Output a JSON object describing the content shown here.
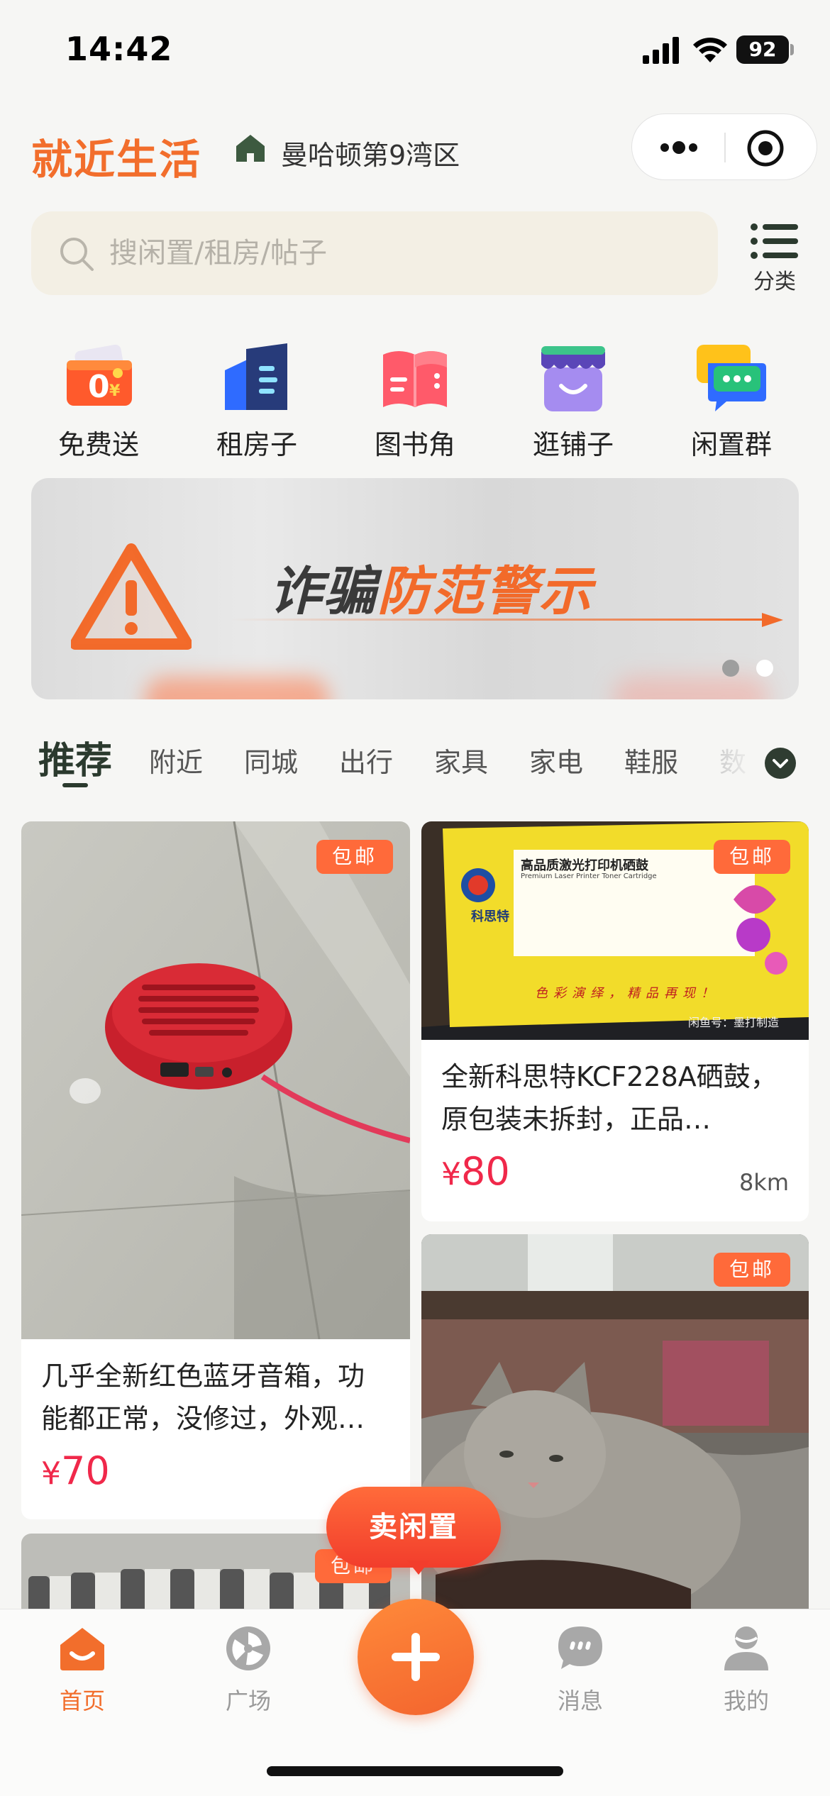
{
  "status_bar": {
    "time": "14:42",
    "battery": "92"
  },
  "header": {
    "brand": "就近生活",
    "location": "曼哈顿第9湾区"
  },
  "search": {
    "placeholder": "搜闲置/租房/帖子",
    "category_label": "分类"
  },
  "quick_nav": [
    {
      "label": "免费送",
      "icon": "free-gift-icon"
    },
    {
      "label": "租房子",
      "icon": "rent-house-icon"
    },
    {
      "label": "图书角",
      "icon": "book-corner-icon"
    },
    {
      "label": "逛铺子",
      "icon": "shop-icon"
    },
    {
      "label": "闲置群",
      "icon": "group-chat-icon"
    }
  ],
  "banner": {
    "text_dark": "诈骗",
    "text_accent": "防范警示",
    "slides": 2,
    "active_slide": 2
  },
  "tabs": [
    "推荐",
    "附近",
    "同城",
    "出行",
    "家具",
    "家电",
    "鞋服",
    "数"
  ],
  "products": [
    {
      "badge": "包邮",
      "title": "几乎全新红色蓝牙音箱，功能都正常，没修过，外观…",
      "price": "70",
      "currency": "¥"
    },
    {
      "badge": "包邮",
      "title": "全新科思特KCF228A硒鼓，原包装未拆封，正品…",
      "price": "80",
      "currency": "¥",
      "distance": "8km",
      "image_text": {
        "brand": "科思特",
        "title": "高品质激光打印机硒鼓",
        "subtitle": "Premium Laser Printer Toner Cartridge",
        "slogan": "色彩演绎，精品再现！",
        "corner": "闲鱼号：墨打制造"
      }
    },
    {
      "badge": "包邮"
    },
    {
      "badge": "包邮"
    }
  ],
  "sell_button": "卖闲置",
  "tabbar": [
    {
      "label": "首页",
      "icon": "home-icon",
      "active": true
    },
    {
      "label": "广场",
      "icon": "plaza-icon",
      "active": false
    },
    {
      "label": "",
      "icon": "plus-icon",
      "active": false
    },
    {
      "label": "消息",
      "icon": "message-icon",
      "active": false
    },
    {
      "label": "我的",
      "icon": "profile-icon",
      "active": false
    }
  ],
  "colors": {
    "brand": "#f26e2c",
    "price": "#f0284a",
    "badge": "#ff6a3a",
    "tab_active": "#2b3a2e"
  }
}
